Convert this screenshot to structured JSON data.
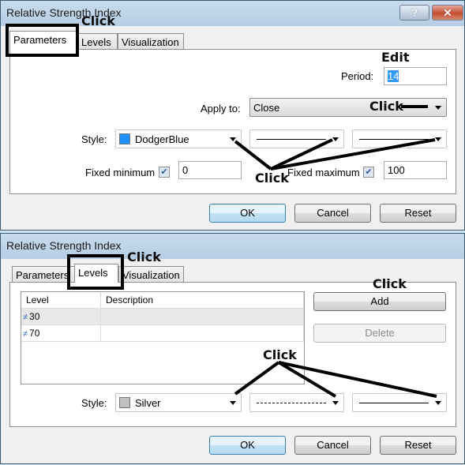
{
  "dialog_top": {
    "title": "Relative Strength Index",
    "help_button": "?",
    "close_button": "✕",
    "tabs": [
      {
        "label": "Parameters",
        "active": true
      },
      {
        "label": "Levels",
        "active": false
      },
      {
        "label": "Visualization",
        "active": false
      }
    ],
    "period": {
      "label": "Period:",
      "value": "14"
    },
    "apply_to": {
      "label": "Apply to:",
      "value": "Close"
    },
    "style": {
      "label": "Style:",
      "color_name": "DodgerBlue",
      "color_hex": "#1e90ff",
      "line_style": "solid",
      "line_width": "thin"
    },
    "fixed_minimum": {
      "label": "Fixed minimum",
      "checked": true,
      "value": "0"
    },
    "fixed_maximum": {
      "label": "Fixed maximum",
      "checked": true,
      "value": "100"
    },
    "buttons": {
      "ok": "OK",
      "cancel": "Cancel",
      "reset": "Reset"
    },
    "annotations": {
      "tab_click": "Click",
      "edit": "Edit",
      "apply_click": "Click",
      "style_click": "Click"
    }
  },
  "dialog_bottom": {
    "title": "Relative Strength Index",
    "tabs": [
      {
        "label": "Parameters",
        "active": false
      },
      {
        "label": "Levels",
        "active": true
      },
      {
        "label": "Visualization",
        "active": false
      }
    ],
    "levels_table": {
      "headers": [
        "Level",
        "Description"
      ],
      "rows": [
        {
          "level": "30",
          "description": "",
          "selected": true
        },
        {
          "level": "70",
          "description": ""
        }
      ],
      "level_icon": "≠"
    },
    "add_button": "Add",
    "delete_button": "Delete",
    "style": {
      "label": "Style:",
      "color_name": "Silver",
      "color_hex": "#c0c0c0",
      "line_style": "dashed",
      "line_width": "thin"
    },
    "buttons": {
      "ok": "OK",
      "cancel": "Cancel",
      "reset": "Reset"
    },
    "annotations": {
      "tab_click": "Click",
      "add_click": "Click",
      "style_click": "Click"
    }
  }
}
